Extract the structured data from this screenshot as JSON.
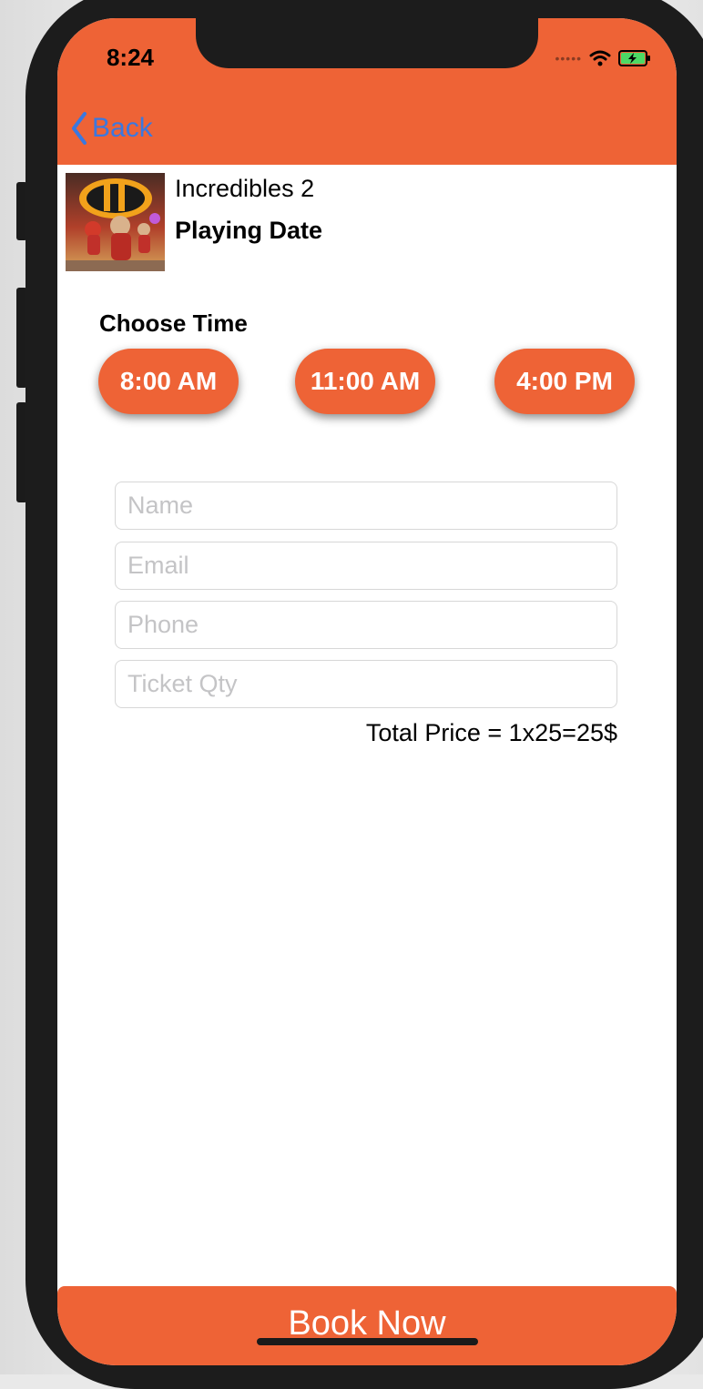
{
  "status_bar": {
    "time": "8:24",
    "signal_icon": "signal-dots-icon",
    "wifi_icon": "wifi-icon",
    "battery_icon": "battery-charging-icon"
  },
  "nav": {
    "back_label": "Back",
    "back_icon": "chevron-left-icon"
  },
  "movie": {
    "title": "Incredibles 2",
    "playing_date_label": "Playing Date",
    "poster_icon": "movie-poster-image"
  },
  "showtimes": {
    "label": "Choose Time",
    "times": [
      "8:00 AM",
      "11:00 AM",
      "4:00 PM"
    ]
  },
  "form": {
    "name_placeholder": "Name",
    "email_placeholder": "Email",
    "phone_placeholder": "Phone",
    "ticket_qty_placeholder": "Ticket Qty",
    "total_price": "Total Price = 1x25=25$"
  },
  "footer": {
    "book_label": "Book Now"
  },
  "colors": {
    "accent": "#ee6336",
    "link": "#3a78e0",
    "battery": "#4cd964"
  }
}
